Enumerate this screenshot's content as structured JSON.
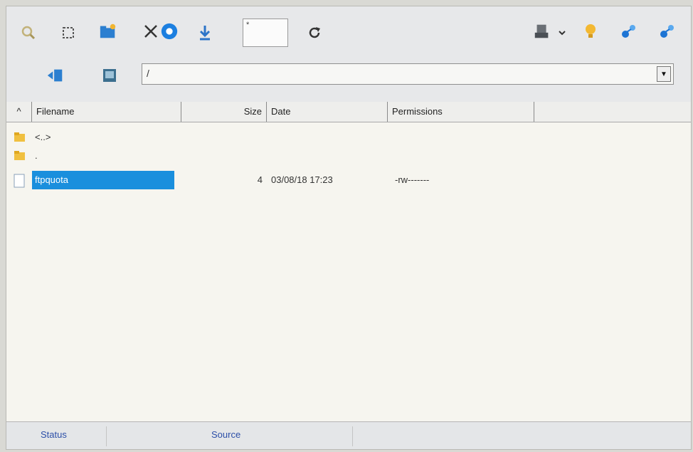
{
  "toolbar": {
    "number_input_value": "*",
    "path_value": "/",
    "icons": [
      "search-icon",
      "select-icon",
      "new-folder-icon",
      "delete-icon",
      "connect-icon",
      "download-icon",
      "refresh-icon",
      "server-icon",
      "chevron-down-icon",
      "bulb-icon",
      "transfer-icon",
      "transfer-icon-2",
      "back-icon",
      "folder-icon"
    ]
  },
  "columns": {
    "sort": "^",
    "filename": "Filename",
    "size": "Size",
    "date": "Date",
    "permissions": "Permissions"
  },
  "files": [
    {
      "name": "<..>",
      "type": "folder",
      "size": "",
      "date": "",
      "permissions": ""
    },
    {
      "name": ".",
      "type": "folder",
      "size": "",
      "date": "",
      "permissions": ""
    },
    {
      "name": "ftpquota",
      "type": "file",
      "size": "4",
      "date": "03/08/18 17:23",
      "permissions": "-rw-------",
      "selected": true
    }
  ],
  "status_bar": {
    "tabs": [
      "Status",
      "Source"
    ]
  },
  "colors": {
    "selection": "#1a8fdd",
    "status_text": "#2c4fa8"
  }
}
